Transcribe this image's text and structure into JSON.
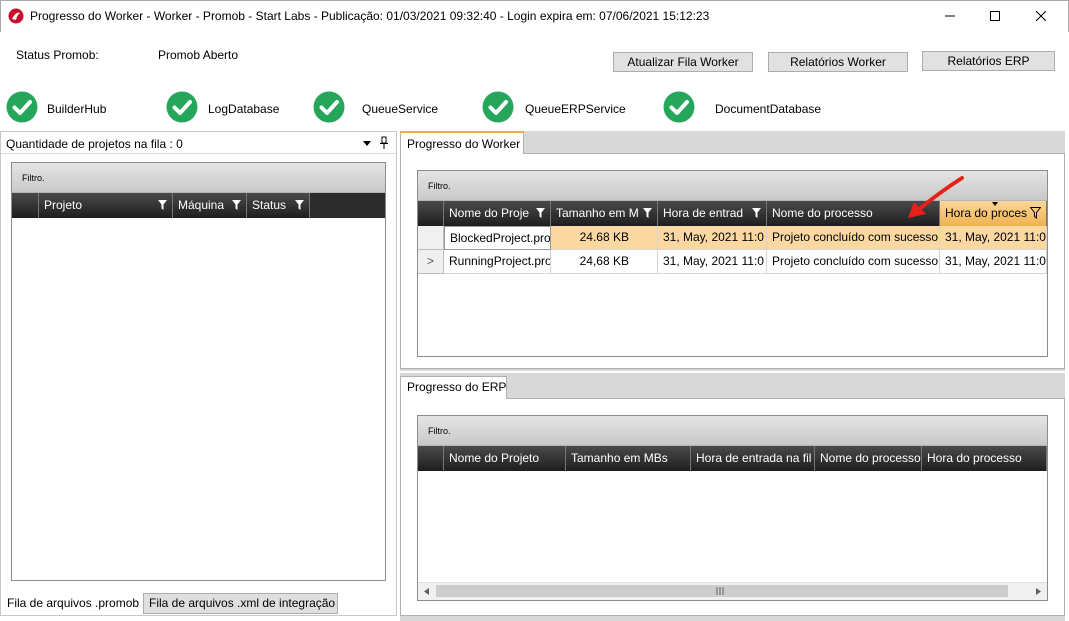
{
  "window": {
    "title": "Progresso do Worker  -  Worker - Promob  -  Start Labs  -  Publicação: 01/03/2021 09:32:40 - Login expira em: 07/06/2021 15:12:23",
    "icon": "app-logo-icon",
    "controls": [
      "minimize-icon",
      "maximize-icon",
      "close-icon"
    ]
  },
  "status": {
    "label": "Status Promob:",
    "value": "Promob Aberto"
  },
  "toolbar": {
    "update_queue": "Atualizar Fila Worker",
    "worker_reports": "Relatórios Worker",
    "erp_reports": "Relatórios ERP"
  },
  "services": [
    {
      "name": "BuilderHub",
      "status": "ok"
    },
    {
      "name": "LogDatabase",
      "status": "ok"
    },
    {
      "name": "QueueService",
      "status": "ok"
    },
    {
      "name": "QueueERPService",
      "status": "ok"
    },
    {
      "name": "DocumentDatabase",
      "status": "ok"
    }
  ],
  "colors": {
    "ok_green": "#26a65b",
    "selected_row": "#fbd8a2",
    "header_dark": "#2a2a2a",
    "active_column": "#f5c36a",
    "annotation_arrow": "#e8201a"
  },
  "queue_panel": {
    "header": "Quantidade de projetos na fila : 0",
    "filter": "Filtro.",
    "columns": [
      "Projeto",
      "Máquina",
      "Status"
    ],
    "rows": [],
    "tabs": [
      "Fila de arquivos .promob",
      "Fila de arquivos .xml de integração"
    ]
  },
  "worker_panel": {
    "tab": "Progresso do Worker",
    "filter": "Filtro.",
    "columns": [
      "Nome do Proje",
      "Tamanho em M",
      "Hora de entrad",
      "Nome do processo",
      "Hora do proces"
    ],
    "rows": [
      {
        "indicator": "",
        "project": "BlockedProject.pro",
        "size": "24.68 KB",
        "entry_time": "31, May, 2021 11:0",
        "process": "Projeto concluído com sucesso",
        "process_time": "31, May, 2021 11:0"
      },
      {
        "indicator": ">",
        "project": "RunningProject.pro",
        "size": "24,68 KB",
        "entry_time": "31, May, 2021 11:0",
        "process": "Projeto concluído com sucesso",
        "process_time": "31, May, 2021 11:0"
      }
    ]
  },
  "erp_panel": {
    "tab": "Progresso do ERP",
    "filter": "Filtro.",
    "columns": [
      "Nome do Projeto",
      "Tamanho em MBs",
      "Hora de entrada na fil",
      "Nome do processo",
      "Hora do processo"
    ],
    "rows": []
  }
}
